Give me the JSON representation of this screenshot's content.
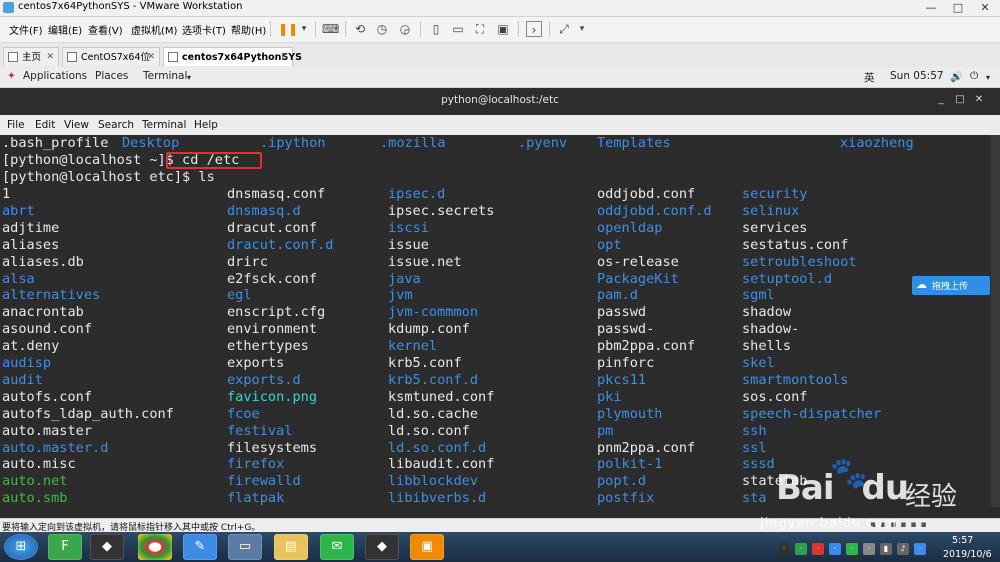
{
  "vmware": {
    "title": "centos7x64PythonSYS - VMware Workstation",
    "window_controls": [
      "—",
      "□",
      "✕"
    ],
    "menu": [
      "文件(F)",
      "编辑(E)",
      "查看(V)",
      "虚拟机(M)",
      "选项卡(T)",
      "帮助(H)"
    ],
    "tabs": [
      {
        "label": "主页",
        "active": false
      },
      {
        "label": "CentOS7x64位",
        "active": false
      },
      {
        "label": "centos7x64PythonSYS",
        "active": true
      }
    ],
    "status_text": "要将输入定向到该虚拟机，请将鼠标指针移入其中或按 Ctrl+G。"
  },
  "gnome": {
    "applications": "Applications",
    "places": "Places",
    "terminal": "Terminal",
    "input_method": "英",
    "clock": "Sun 05:57"
  },
  "terminal": {
    "title": "python@localhost:/etc",
    "menu": [
      "File",
      "Edit",
      "View",
      "Search",
      "Terminal",
      "Help"
    ],
    "top_line": [
      {
        "text": ".bash_profile",
        "color": "#e8e8e8"
      },
      {
        "text": "Desktop",
        "color": "#3d8fe6"
      },
      {
        "text": ".ipython",
        "color": "#3d8fe6"
      },
      {
        "text": ".mozilla",
        "color": "#3d8fe6"
      },
      {
        "text": ".pyenv",
        "color": "#3d8fe6"
      },
      {
        "text": "Templates",
        "color": "#3d8fe6"
      },
      {
        "text": "xiaozheng",
        "color": "#3d8fe6"
      }
    ],
    "prompt_cd": "[python@localhost ~]$ cd /etc",
    "prompt_ls": "[python@localhost etc]$ ls",
    "listing": [
      [
        [
          "1",
          "#e8e8e8"
        ],
        [
          "dnsmasq.conf",
          "#e8e8e8"
        ],
        [
          "ipsec.d",
          "#3d8fe6"
        ],
        [
          "oddjobd.conf",
          "#e8e8e8"
        ],
        [
          "security",
          "#3d8fe6"
        ]
      ],
      [
        [
          "abrt",
          "#3d8fe6"
        ],
        [
          "dnsmasq.d",
          "#3d8fe6"
        ],
        [
          "ipsec.secrets",
          "#e8e8e8"
        ],
        [
          "oddjobd.conf.d",
          "#3d8fe6"
        ],
        [
          "selinux",
          "#3d8fe6"
        ]
      ],
      [
        [
          "adjtime",
          "#e8e8e8"
        ],
        [
          "dracut.conf",
          "#e8e8e8"
        ],
        [
          "iscsi",
          "#3d8fe6"
        ],
        [
          "openldap",
          "#3d8fe6"
        ],
        [
          "services",
          "#e8e8e8"
        ]
      ],
      [
        [
          "aliases",
          "#e8e8e8"
        ],
        [
          "dracut.conf.d",
          "#3d8fe6"
        ],
        [
          "issue",
          "#e8e8e8"
        ],
        [
          "opt",
          "#3d8fe6"
        ],
        [
          "sestatus.conf",
          "#e8e8e8"
        ]
      ],
      [
        [
          "aliases.db",
          "#e8e8e8"
        ],
        [
          "drirc",
          "#e8e8e8"
        ],
        [
          "issue.net",
          "#e8e8e8"
        ],
        [
          "os-release",
          "#e8e8e8"
        ],
        [
          "setroubleshoot",
          "#3d8fe6"
        ]
      ],
      [
        [
          "alsa",
          "#3d8fe6"
        ],
        [
          "e2fsck.conf",
          "#e8e8e8"
        ],
        [
          "java",
          "#3d8fe6"
        ],
        [
          "PackageKit",
          "#3d8fe6"
        ],
        [
          "setuptool.d",
          "#3d8fe6"
        ]
      ],
      [
        [
          "alternatives",
          "#3d8fe6"
        ],
        [
          "egl",
          "#3d8fe6"
        ],
        [
          "jvm",
          "#3d8fe6"
        ],
        [
          "pam.d",
          "#3d8fe6"
        ],
        [
          "sgml",
          "#3d8fe6"
        ]
      ],
      [
        [
          "anacrontab",
          "#e8e8e8"
        ],
        [
          "enscript.cfg",
          "#e8e8e8"
        ],
        [
          "jvm-commmon",
          "#3d8fe6"
        ],
        [
          "passwd",
          "#e8e8e8"
        ],
        [
          "shadow",
          "#e8e8e8"
        ]
      ],
      [
        [
          "asound.conf",
          "#e8e8e8"
        ],
        [
          "environment",
          "#e8e8e8"
        ],
        [
          "kdump.conf",
          "#e8e8e8"
        ],
        [
          "passwd-",
          "#e8e8e8"
        ],
        [
          "shadow-",
          "#e8e8e8"
        ]
      ],
      [
        [
          "at.deny",
          "#e8e8e8"
        ],
        [
          "ethertypes",
          "#e8e8e8"
        ],
        [
          "kernel",
          "#3d8fe6"
        ],
        [
          "pbm2ppa.conf",
          "#e8e8e8"
        ],
        [
          "shells",
          "#e8e8e8"
        ]
      ],
      [
        [
          "audisp",
          "#3d8fe6"
        ],
        [
          "exports",
          "#e8e8e8"
        ],
        [
          "krb5.conf",
          "#e8e8e8"
        ],
        [
          "pinforc",
          "#e8e8e8"
        ],
        [
          "skel",
          "#3d8fe6"
        ]
      ],
      [
        [
          "audit",
          "#3d8fe6"
        ],
        [
          "exports.d",
          "#3d8fe6"
        ],
        [
          "krb5.conf.d",
          "#3d8fe6"
        ],
        [
          "pkcs11",
          "#3d8fe6"
        ],
        [
          "smartmontools",
          "#3d8fe6"
        ]
      ],
      [
        [
          "autofs.conf",
          "#e8e8e8"
        ],
        [
          "favicon.png",
          "#35d4d4"
        ],
        [
          "ksmtuned.conf",
          "#e8e8e8"
        ],
        [
          "pki",
          "#3d8fe6"
        ],
        [
          "sos.conf",
          "#e8e8e8"
        ]
      ],
      [
        [
          "autofs_ldap_auth.conf",
          "#e8e8e8"
        ],
        [
          "fcoe",
          "#3d8fe6"
        ],
        [
          "ld.so.cache",
          "#e8e8e8"
        ],
        [
          "plymouth",
          "#3d8fe6"
        ],
        [
          "speech-dispatcher",
          "#3d8fe6"
        ]
      ],
      [
        [
          "auto.master",
          "#e8e8e8"
        ],
        [
          "festival",
          "#3d8fe6"
        ],
        [
          "ld.so.conf",
          "#e8e8e8"
        ],
        [
          "pm",
          "#3d8fe6"
        ],
        [
          "ssh",
          "#3d8fe6"
        ]
      ],
      [
        [
          "auto.master.d",
          "#3d8fe6"
        ],
        [
          "filesystems",
          "#e8e8e8"
        ],
        [
          "ld.so.conf.d",
          "#3d8fe6"
        ],
        [
          "pnm2ppa.conf",
          "#e8e8e8"
        ],
        [
          "ssl",
          "#3d8fe6"
        ]
      ],
      [
        [
          "auto.misc",
          "#e8e8e8"
        ],
        [
          "firefox",
          "#3d8fe6"
        ],
        [
          "libaudit.conf",
          "#e8e8e8"
        ],
        [
          "polkit-1",
          "#3d8fe6"
        ],
        [
          "sssd",
          "#3d8fe6"
        ]
      ],
      [
        [
          "auto.net",
          "#3dbb3d"
        ],
        [
          "firewalld",
          "#3d8fe6"
        ],
        [
          "libblockdev",
          "#3d8fe6"
        ],
        [
          "popt.d",
          "#3d8fe6"
        ],
        [
          "statetab",
          "#e8e8e8"
        ]
      ],
      [
        [
          "auto.smb",
          "#3dbb3d"
        ],
        [
          "flatpak",
          "#3d8fe6"
        ],
        [
          "libibverbs.d",
          "#3d8fe6"
        ],
        [
          "postfix",
          "#3d8fe6"
        ],
        [
          "sta",
          "#3d8fe6"
        ]
      ]
    ]
  },
  "float_widget": {
    "label": "拖拽上传"
  },
  "taskbar": {
    "time": "5:57",
    "date": "2019/10/6"
  },
  "watermark": {
    "brand": "Bai",
    "brand2": "du",
    "jingyan": "经验",
    "url": "jingyan.baidu.com"
  }
}
